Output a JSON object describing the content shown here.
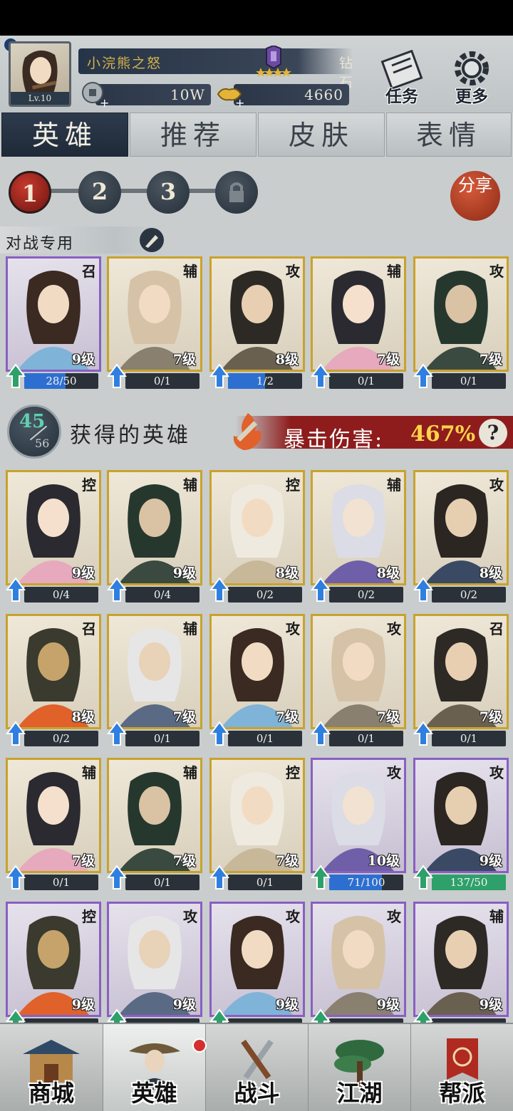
{
  "player": {
    "name": "小浣熊之怒",
    "level_label": "Lv.10",
    "rank_label": "钻石4",
    "silver": "10W",
    "gold": "4660"
  },
  "top_buttons": {
    "tasks": "任务",
    "more": "更多"
  },
  "tabs": [
    "英雄",
    "推荐",
    "皮肤",
    "表情"
  ],
  "teams": [
    "1",
    "2",
    "3"
  ],
  "share_label": "分享",
  "battle_section_label": "对战专用",
  "battle_team": [
    {
      "role": "召",
      "level": "9级",
      "progress": "28/50",
      "progress_fraction": 0.56,
      "rarity": "purple"
    },
    {
      "role": "辅",
      "level": "7级",
      "progress": "0/1",
      "progress_fraction": 0,
      "rarity": "gold"
    },
    {
      "role": "攻",
      "level": "8级",
      "progress": "1/2",
      "progress_fraction": 0.5,
      "rarity": "gold"
    },
    {
      "role": "辅",
      "level": "7级",
      "progress": "0/1",
      "progress_fraction": 0,
      "rarity": "gold"
    },
    {
      "role": "攻",
      "level": "7级",
      "progress": "0/1",
      "progress_fraction": 0,
      "rarity": "gold"
    }
  ],
  "heroes_header": {
    "owned": "45",
    "total": "56",
    "title": "获得的英雄",
    "crit_label": "暴击伤害:",
    "crit_value": "467%",
    "help": "?"
  },
  "heroes": [
    {
      "role": "控",
      "level": "9级",
      "progress": "0/4",
      "progress_fraction": 0,
      "rarity": "gold"
    },
    {
      "role": "辅",
      "level": "9级",
      "progress": "0/4",
      "progress_fraction": 0,
      "rarity": "gold"
    },
    {
      "role": "控",
      "level": "8级",
      "progress": "0/2",
      "progress_fraction": 0,
      "rarity": "gold"
    },
    {
      "role": "辅",
      "level": "8级",
      "progress": "0/2",
      "progress_fraction": 0,
      "rarity": "gold"
    },
    {
      "role": "攻",
      "level": "8级",
      "progress": "0/2",
      "progress_fraction": 0,
      "rarity": "gold"
    },
    {
      "role": "召",
      "level": "8级",
      "progress": "0/2",
      "progress_fraction": 0,
      "rarity": "gold"
    },
    {
      "role": "辅",
      "level": "7级",
      "progress": "0/1",
      "progress_fraction": 0,
      "rarity": "gold"
    },
    {
      "role": "攻",
      "level": "7级",
      "progress": "0/1",
      "progress_fraction": 0,
      "rarity": "gold"
    },
    {
      "role": "攻",
      "level": "7级",
      "progress": "0/1",
      "progress_fraction": 0,
      "rarity": "gold"
    },
    {
      "role": "召",
      "level": "7级",
      "progress": "0/1",
      "progress_fraction": 0,
      "rarity": "gold"
    },
    {
      "role": "辅",
      "level": "7级",
      "progress": "0/1",
      "progress_fraction": 0,
      "rarity": "gold"
    },
    {
      "role": "辅",
      "level": "7级",
      "progress": "0/1",
      "progress_fraction": 0,
      "rarity": "gold"
    },
    {
      "role": "控",
      "level": "7级",
      "progress": "0/1",
      "progress_fraction": 0,
      "rarity": "gold"
    },
    {
      "role": "攻",
      "level": "10级",
      "progress": "71/100",
      "progress_fraction": 0.71,
      "rarity": "purple"
    },
    {
      "role": "攻",
      "level": "9级",
      "progress": "137/50",
      "progress_fraction": 1,
      "rarity": "purple",
      "bar_color": "green"
    },
    {
      "role": "控",
      "level": "9级",
      "progress": "",
      "progress_fraction": 0,
      "rarity": "purple"
    },
    {
      "role": "攻",
      "level": "9级",
      "progress": "",
      "progress_fraction": 0,
      "rarity": "purple"
    },
    {
      "role": "攻",
      "level": "9级",
      "progress": "",
      "progress_fraction": 0,
      "rarity": "purple"
    },
    {
      "role": "攻",
      "level": "9级",
      "progress": "",
      "progress_fraction": 0,
      "rarity": "purple"
    },
    {
      "role": "辅",
      "level": "9级",
      "progress": "",
      "progress_fraction": 0,
      "rarity": "purple"
    }
  ],
  "bottom_nav": [
    "商城",
    "英雄",
    "战斗",
    "江湖",
    "帮派"
  ],
  "colors": {
    "accent_red": "#8e1c1c",
    "gold_frame": "#c9a22c",
    "purple_frame": "#8a5fc2",
    "owned_count": "#5fd0b0"
  }
}
